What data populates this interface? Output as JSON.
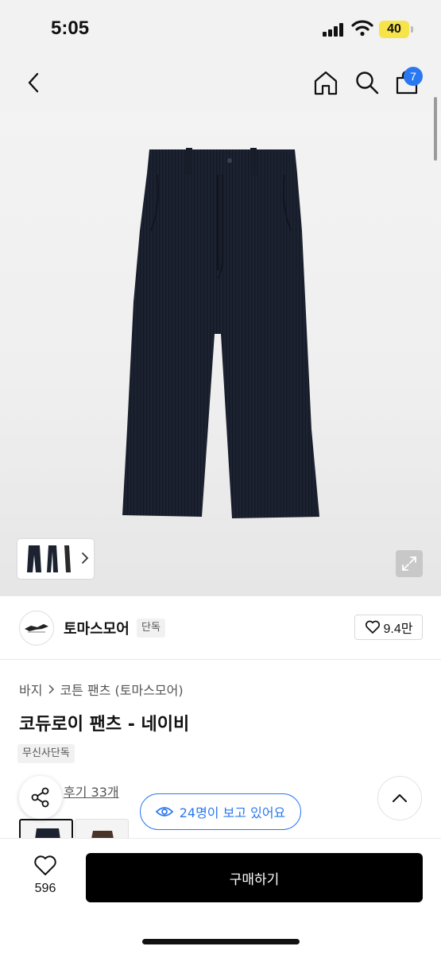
{
  "status_bar": {
    "time": "5:05",
    "battery": "40"
  },
  "nav": {
    "cart_count": "7",
    "icons": [
      "back-icon",
      "home-icon",
      "search-icon",
      "cart-icon"
    ]
  },
  "brand": {
    "name": "토마스모어",
    "tag": "단독",
    "likes": "9.4만"
  },
  "breadcrumb": {
    "category": "바지",
    "subcategory": "코튼 팬츠 (토마스모어)"
  },
  "product": {
    "title": "코듀로이 팬츠 - 네이비",
    "tag": "무신사단독",
    "reviews": "후기 33개"
  },
  "viewers": {
    "text": "24명이 보고 있어요"
  },
  "bottom": {
    "wish_count": "596",
    "buy_label": "구매하기"
  },
  "colors": {
    "accent": "#2a78f0",
    "buy_button": "#000000",
    "pants": "#1c2230",
    "battery": "#f7e34a"
  }
}
